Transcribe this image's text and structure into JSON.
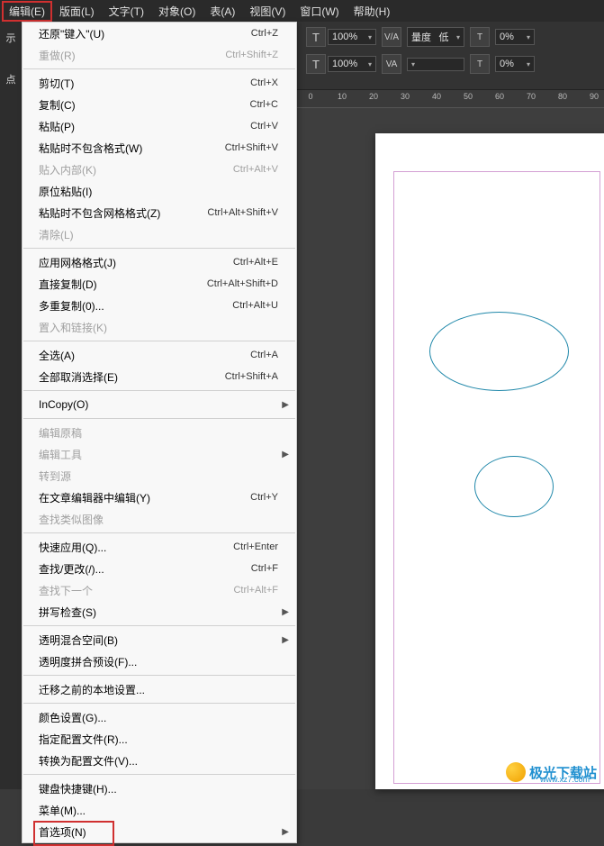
{
  "menubar": {
    "items": [
      "编辑(E)",
      "版面(L)",
      "文字(T)",
      "对象(O)",
      "表(A)",
      "视图(V)",
      "窗口(W)",
      "帮助(H)"
    ]
  },
  "toolbar": {
    "percent1": "100%",
    "percent2": "100%",
    "metric_label": "量度",
    "metric_value": "低",
    "zero1": "0%",
    "zero2": "0%"
  },
  "ruler": {
    "labels": [
      "0",
      "10",
      "20",
      "30",
      "40",
      "50",
      "60",
      "70",
      "80",
      "90"
    ]
  },
  "left_stub": {
    "l1": "示",
    "l2": "点"
  },
  "menu": [
    {
      "type": "item",
      "label": "还原\"键入\"(U)",
      "shortcut": "Ctrl+Z",
      "disabled": false
    },
    {
      "type": "item",
      "label": "重做(R)",
      "shortcut": "Ctrl+Shift+Z",
      "disabled": true
    },
    {
      "type": "sep"
    },
    {
      "type": "item",
      "label": "剪切(T)",
      "shortcut": "Ctrl+X",
      "disabled": false
    },
    {
      "type": "item",
      "label": "复制(C)",
      "shortcut": "Ctrl+C",
      "disabled": false
    },
    {
      "type": "item",
      "label": "粘贴(P)",
      "shortcut": "Ctrl+V",
      "disabled": false
    },
    {
      "type": "item",
      "label": "粘贴时不包含格式(W)",
      "shortcut": "Ctrl+Shift+V",
      "disabled": false
    },
    {
      "type": "item",
      "label": "贴入内部(K)",
      "shortcut": "Ctrl+Alt+V",
      "disabled": true
    },
    {
      "type": "item",
      "label": "原位粘贴(I)",
      "shortcut": "",
      "disabled": false
    },
    {
      "type": "item",
      "label": "粘贴时不包含网格格式(Z)",
      "shortcut": "Ctrl+Alt+Shift+V",
      "disabled": false
    },
    {
      "type": "item",
      "label": "清除(L)",
      "shortcut": "",
      "disabled": true
    },
    {
      "type": "sep"
    },
    {
      "type": "item",
      "label": "应用网格格式(J)",
      "shortcut": "Ctrl+Alt+E",
      "disabled": false
    },
    {
      "type": "item",
      "label": "直接复制(D)",
      "shortcut": "Ctrl+Alt+Shift+D",
      "disabled": false
    },
    {
      "type": "item",
      "label": "多重复制(0)...",
      "shortcut": "Ctrl+Alt+U",
      "disabled": false
    },
    {
      "type": "item",
      "label": "置入和链接(K)",
      "shortcut": "",
      "disabled": true
    },
    {
      "type": "sep"
    },
    {
      "type": "item",
      "label": "全选(A)",
      "shortcut": "Ctrl+A",
      "disabled": false
    },
    {
      "type": "item",
      "label": "全部取消选择(E)",
      "shortcut": "Ctrl+Shift+A",
      "disabled": false
    },
    {
      "type": "sep"
    },
    {
      "type": "item",
      "label": "InCopy(O)",
      "shortcut": "",
      "disabled": false,
      "submenu": true
    },
    {
      "type": "sep"
    },
    {
      "type": "item",
      "label": "编辑原稿",
      "shortcut": "",
      "disabled": true
    },
    {
      "type": "item",
      "label": "编辑工具",
      "shortcut": "",
      "disabled": true,
      "submenu": true
    },
    {
      "type": "item",
      "label": "转到源",
      "shortcut": "",
      "disabled": true
    },
    {
      "type": "item",
      "label": "在文章编辑器中编辑(Y)",
      "shortcut": "Ctrl+Y",
      "disabled": false
    },
    {
      "type": "item",
      "label": "查找类似图像",
      "shortcut": "",
      "disabled": true
    },
    {
      "type": "sep"
    },
    {
      "type": "item",
      "label": "快速应用(Q)...",
      "shortcut": "Ctrl+Enter",
      "disabled": false
    },
    {
      "type": "item",
      "label": "查找/更改(/)...",
      "shortcut": "Ctrl+F",
      "disabled": false
    },
    {
      "type": "item",
      "label": "查找下一个",
      "shortcut": "Ctrl+Alt+F",
      "disabled": true
    },
    {
      "type": "item",
      "label": "拼写检查(S)",
      "shortcut": "",
      "disabled": false,
      "submenu": true
    },
    {
      "type": "sep"
    },
    {
      "type": "item",
      "label": "透明混合空间(B)",
      "shortcut": "",
      "disabled": false,
      "submenu": true
    },
    {
      "type": "item",
      "label": "透明度拼合预设(F)...",
      "shortcut": "",
      "disabled": false
    },
    {
      "type": "sep"
    },
    {
      "type": "item",
      "label": "迁移之前的本地设置...",
      "shortcut": "",
      "disabled": false
    },
    {
      "type": "sep"
    },
    {
      "type": "item",
      "label": "颜色设置(G)...",
      "shortcut": "",
      "disabled": false
    },
    {
      "type": "item",
      "label": "指定配置文件(R)...",
      "shortcut": "",
      "disabled": false
    },
    {
      "type": "item",
      "label": "转换为配置文件(V)...",
      "shortcut": "",
      "disabled": false
    },
    {
      "type": "sep"
    },
    {
      "type": "item",
      "label": "键盘快捷键(H)...",
      "shortcut": "",
      "disabled": false
    },
    {
      "type": "item",
      "label": "菜单(M)...",
      "shortcut": "",
      "disabled": false
    },
    {
      "type": "item",
      "label": "首选项(N)",
      "shortcut": "",
      "disabled": false,
      "submenu": true,
      "boxed": true
    }
  ],
  "watermark": {
    "brand": "极光下载站",
    "url": "www.xz7.com"
  }
}
